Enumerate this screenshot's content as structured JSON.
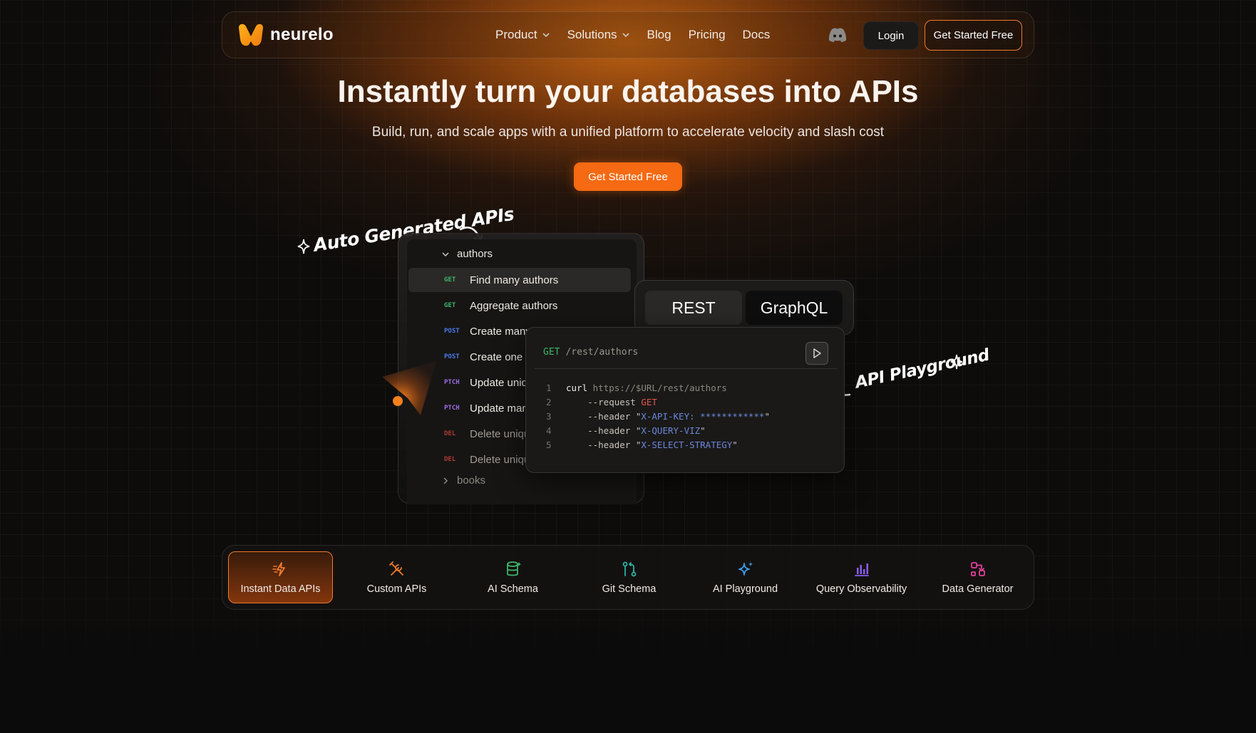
{
  "brand": {
    "name": "neurelo",
    "logo_icon": "neurelo-logo-icon"
  },
  "nav": {
    "links": [
      {
        "label": "Product",
        "has_dropdown": true
      },
      {
        "label": "Solutions",
        "has_dropdown": true
      },
      {
        "label": "Blog",
        "has_dropdown": false
      },
      {
        "label": "Pricing",
        "has_dropdown": false
      },
      {
        "label": "Docs",
        "has_dropdown": false
      }
    ],
    "discord_icon": "discord-icon",
    "login_label": "Login",
    "cta_label": "Get Started Free"
  },
  "hero": {
    "title": "Instantly turn your databases into APIs",
    "subtitle": "Build, run, and scale apps with a unified platform to accelerate velocity and slash cost",
    "cta_label": "Get Started Free"
  },
  "annotations": {
    "auto": "Auto Generated APIs",
    "playground": "API Playground"
  },
  "api_explorer": {
    "group_open": "authors",
    "group_closed": "books",
    "items": [
      {
        "method": "GET",
        "label": "Find many authors"
      },
      {
        "method": "GET",
        "label": "Aggregate authors"
      },
      {
        "method": "POST",
        "label": "Create many"
      },
      {
        "method": "POST",
        "label": "Create one a"
      },
      {
        "method": "PTCH",
        "label": "Update uniq"
      },
      {
        "method": "PTCH",
        "label": "Update many"
      },
      {
        "method": "DEL",
        "label": "Delete uniqu"
      },
      {
        "method": "DEL",
        "label": "Delete uniqu"
      }
    ]
  },
  "tabs": {
    "rest": "REST",
    "graphql": "GraphQL"
  },
  "code": {
    "method": "GET",
    "path": "/rest/authors",
    "lines": [
      {
        "n": "1",
        "parts": [
          [
            "c-cmd",
            "curl "
          ],
          [
            "c-url",
            "https://$URL/rest/authors"
          ]
        ]
      },
      {
        "n": "2",
        "parts": [
          [
            "c-flag",
            "    --request "
          ],
          [
            "c-val-red",
            "GET"
          ]
        ]
      },
      {
        "n": "3",
        "parts": [
          [
            "c-flag",
            "    --header \""
          ],
          [
            "c-val-blue",
            "X-API-KEY: ************"
          ],
          [
            "c-str",
            "\""
          ]
        ]
      },
      {
        "n": "4",
        "parts": [
          [
            "c-flag",
            "    --header \""
          ],
          [
            "c-val-blue",
            "X-QUERY-VIZ"
          ],
          [
            "c-str",
            "\""
          ]
        ]
      },
      {
        "n": "5",
        "parts": [
          [
            "c-flag",
            "    --header \""
          ],
          [
            "c-val-blue",
            "X-SELECT-STRATEGY"
          ],
          [
            "c-str",
            "\""
          ]
        ]
      }
    ]
  },
  "features": [
    {
      "label": "Instant Data APIs",
      "icon": "lightning-icon",
      "color": "#f07a2c",
      "active": true
    },
    {
      "label": "Custom APIs",
      "icon": "tools-icon",
      "color": "#f07a2c",
      "active": false
    },
    {
      "label": "AI Schema",
      "icon": "database-icon",
      "color": "#3db56a",
      "active": false
    },
    {
      "label": "Git Schema",
      "icon": "git-branch-icon",
      "color": "#2bb3a8",
      "active": false
    },
    {
      "label": "AI Playground",
      "icon": "sparkle-icon",
      "color": "#3a9ce8",
      "active": false
    },
    {
      "label": "Query Observability",
      "icon": "bar-chart-icon",
      "color": "#8a5cf0",
      "active": false
    },
    {
      "label": "Data Generator",
      "icon": "data-generator-icon",
      "color": "#e0409a",
      "active": false
    }
  ]
}
